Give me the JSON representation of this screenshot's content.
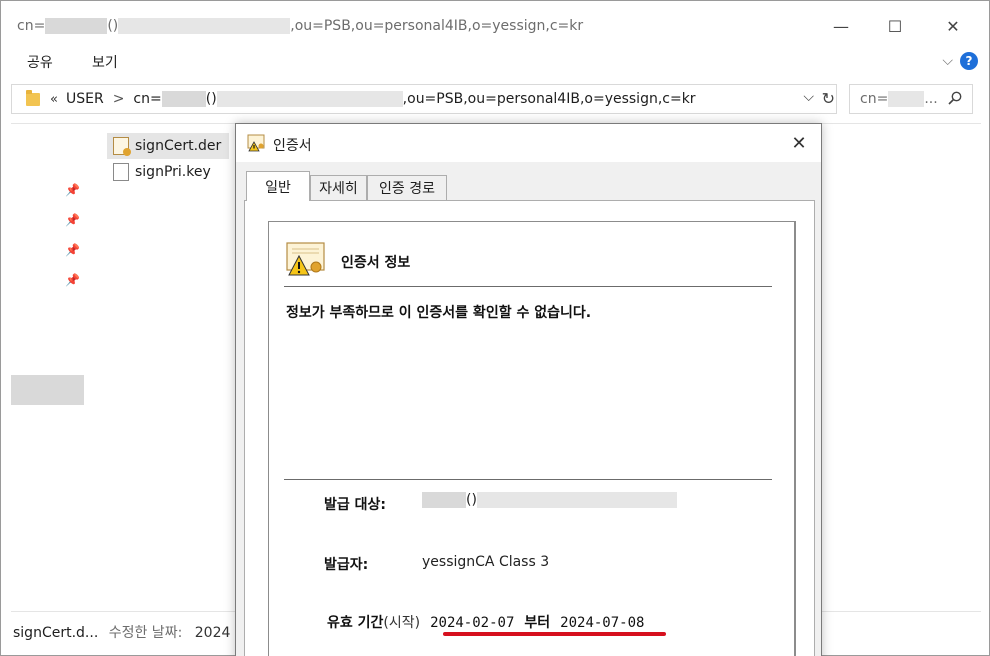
{
  "explorer": {
    "title_prefix": "cn=",
    "title_mid": "()",
    "title_suffix": ",ou=PSB,ou=personal4IB,o=yessign,c=kr",
    "controls": {
      "minimize": "—",
      "maximize": "☐",
      "close": "✕"
    },
    "ribbon": {
      "share": "공유",
      "view": "보기",
      "expand": "⌵",
      "help": "?"
    },
    "address": {
      "chevron": "«",
      "root": "USER",
      "separator": ">",
      "path_prefix": "cn=",
      "path_mid": "()",
      "path_suffix": ",ou=PSB,ou=personal4IB,o=yessign,c=kr",
      "dropdown": "⌵",
      "refresh": "↻"
    },
    "search": {
      "prefix": "cn=",
      "ellipsis": "..."
    },
    "files": [
      {
        "name": "signCert.der",
        "selected": true
      },
      {
        "name": "signPri.key",
        "selected": false
      }
    ],
    "status": {
      "name": "signCert.d...",
      "label": "수정한 날짜:",
      "date": "2024"
    }
  },
  "dialog": {
    "title": "인증서",
    "close": "✕",
    "tabs": [
      "일반",
      "자세히",
      "인증 경로"
    ],
    "heading": "인증서 정보",
    "message": "정보가 부족하므로 이 인증서를 확인할 수 없습니다.",
    "issued_to_label": "발급 대상:",
    "issued_to_mid": "()",
    "issued_by_label": "발급자:",
    "issued_by_value": "yessignCA Class 3",
    "validity_label": "유효 기간",
    "validity_suffix": "(시작)",
    "valid_from": "2024-02-07",
    "valid_word": "부터",
    "valid_to": "2024-07-08"
  },
  "colors": {
    "accent_blue": "#1e6fd9",
    "underline_red": "#d6101e",
    "redaction": "#d9d9d9"
  }
}
